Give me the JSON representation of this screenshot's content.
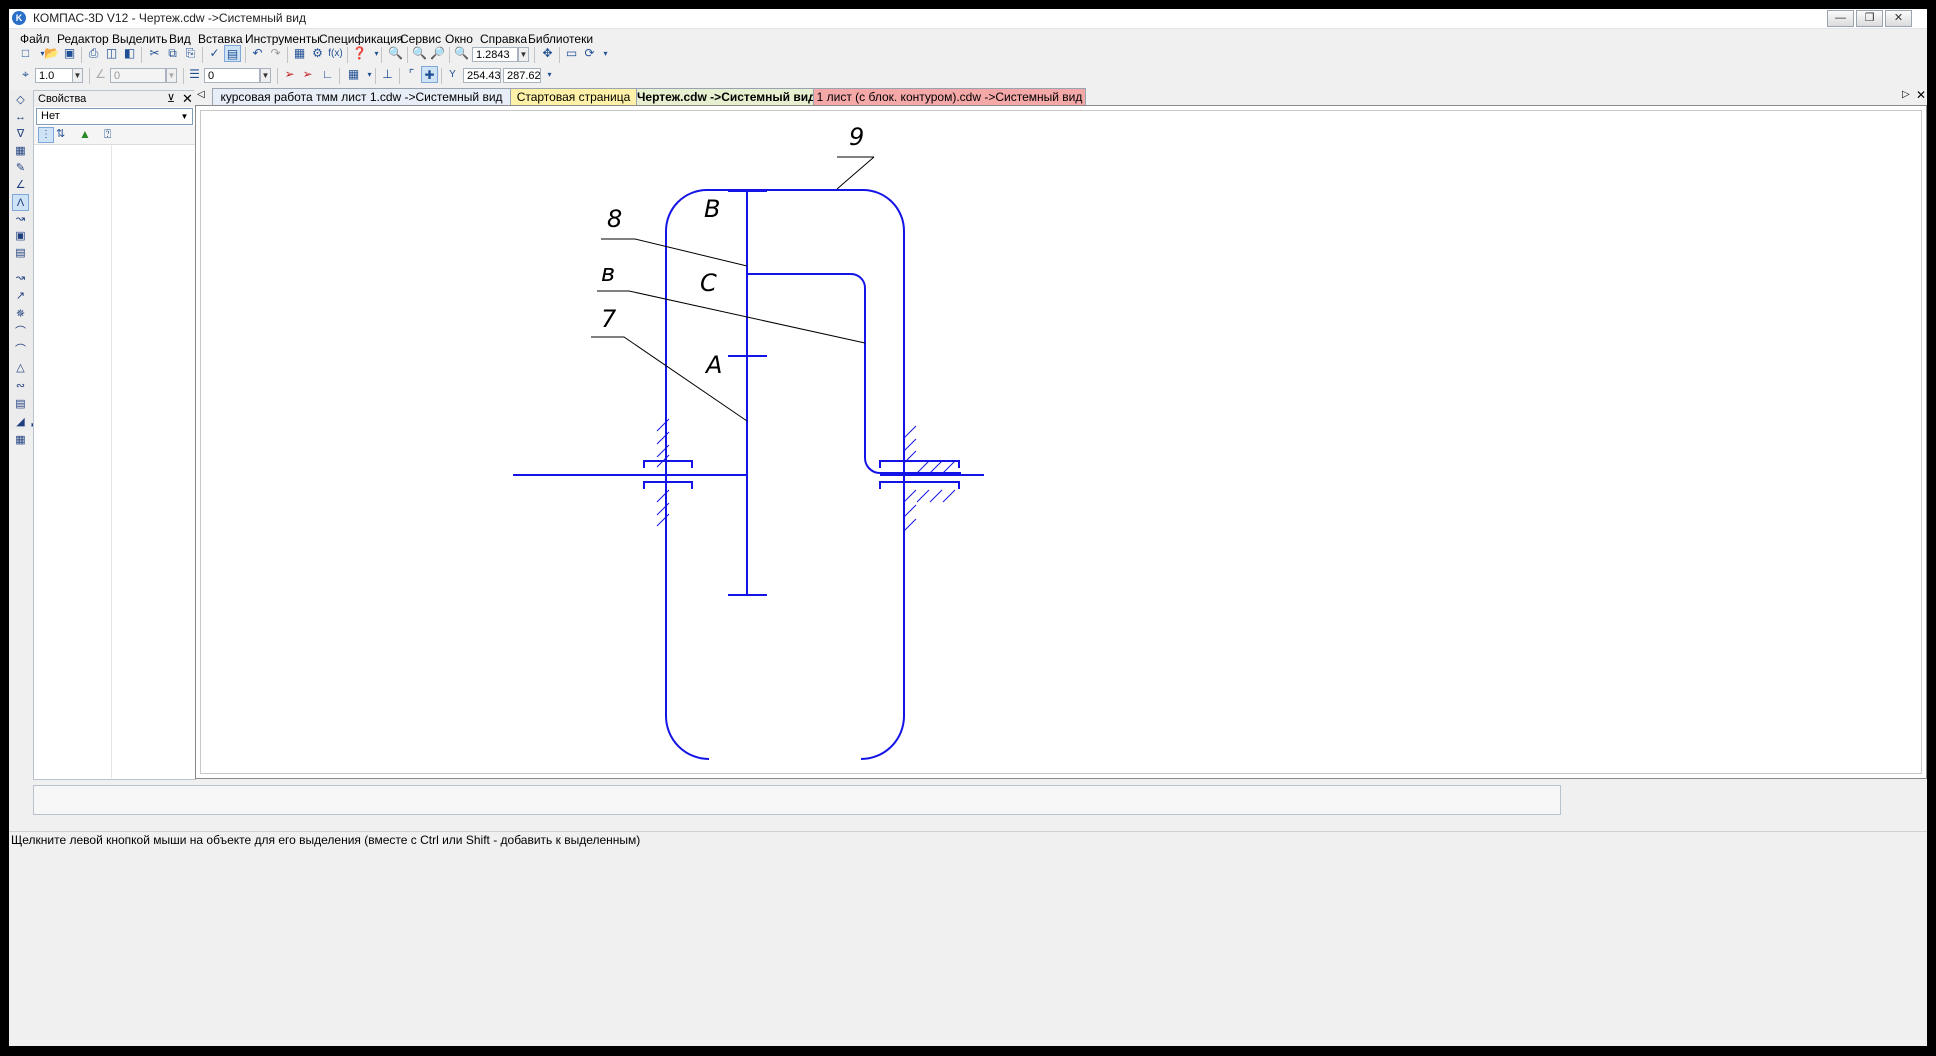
{
  "window": {
    "title": "КОМПАС-3D V12 - Чертеж.cdw ->Системный вид",
    "logo": "K",
    "buttons": [
      "minimize",
      "restore",
      "close"
    ]
  },
  "menu": {
    "items": [
      "Файл",
      "Редактор",
      "Выделить",
      "Вид",
      "Вставка",
      "Инструменты",
      "Спецификация",
      "Сервис",
      "Окно",
      "Справка",
      "Библиотеки"
    ]
  },
  "toolbar_standard": {
    "zoom_value": "1.2843",
    "icons": [
      "new-icon",
      "open-icon",
      "save-icon",
      "print-icon",
      "preview-icon",
      "cut-icon",
      "copy-icon",
      "paste-icon",
      "properties-icon",
      "undo-icon",
      "redo-icon",
      "manager-icon",
      "variables-icon",
      "help-icon",
      "zoom-window-icon",
      "zoom-in-icon",
      "zoom-out-icon",
      "pan-icon",
      "refresh-icon"
    ]
  },
  "toolbar_current": {
    "step_value": "1.0",
    "angle_value": "0",
    "layer_value": "0",
    "coord_x": "254.435",
    "coord_y": "287.629"
  },
  "properties_panel": {
    "title": "Свойства",
    "select_value": "Нет"
  },
  "tabs": [
    {
      "label": "курсовая работа тмм лист 1.cdw ->Системный вид",
      "active": false,
      "color": "#e8eef7"
    },
    {
      "label": "Стартовая страница",
      "active": false,
      "color": "#fff2a8"
    },
    {
      "label": "Чертеж.cdw ->Системный вид",
      "active": true,
      "color": "#e6f0d0"
    },
    {
      "label": "1 лист (с блок. контуром).cdw ->Системный вид",
      "active": false,
      "color": "#f4a8a8"
    }
  ],
  "drawing": {
    "line_color": "#1414e6",
    "labels": {
      "l9": "9",
      "l8": "8",
      "lB1": "B",
      "lC": "C",
      "lB2": "в",
      "l7": "7",
      "lA": "A"
    }
  },
  "status": {
    "text": "Щелкните левой кнопкой мыши на объекте для его выделения (вместе с Ctrl или Shift - добавить к выделенным)"
  }
}
